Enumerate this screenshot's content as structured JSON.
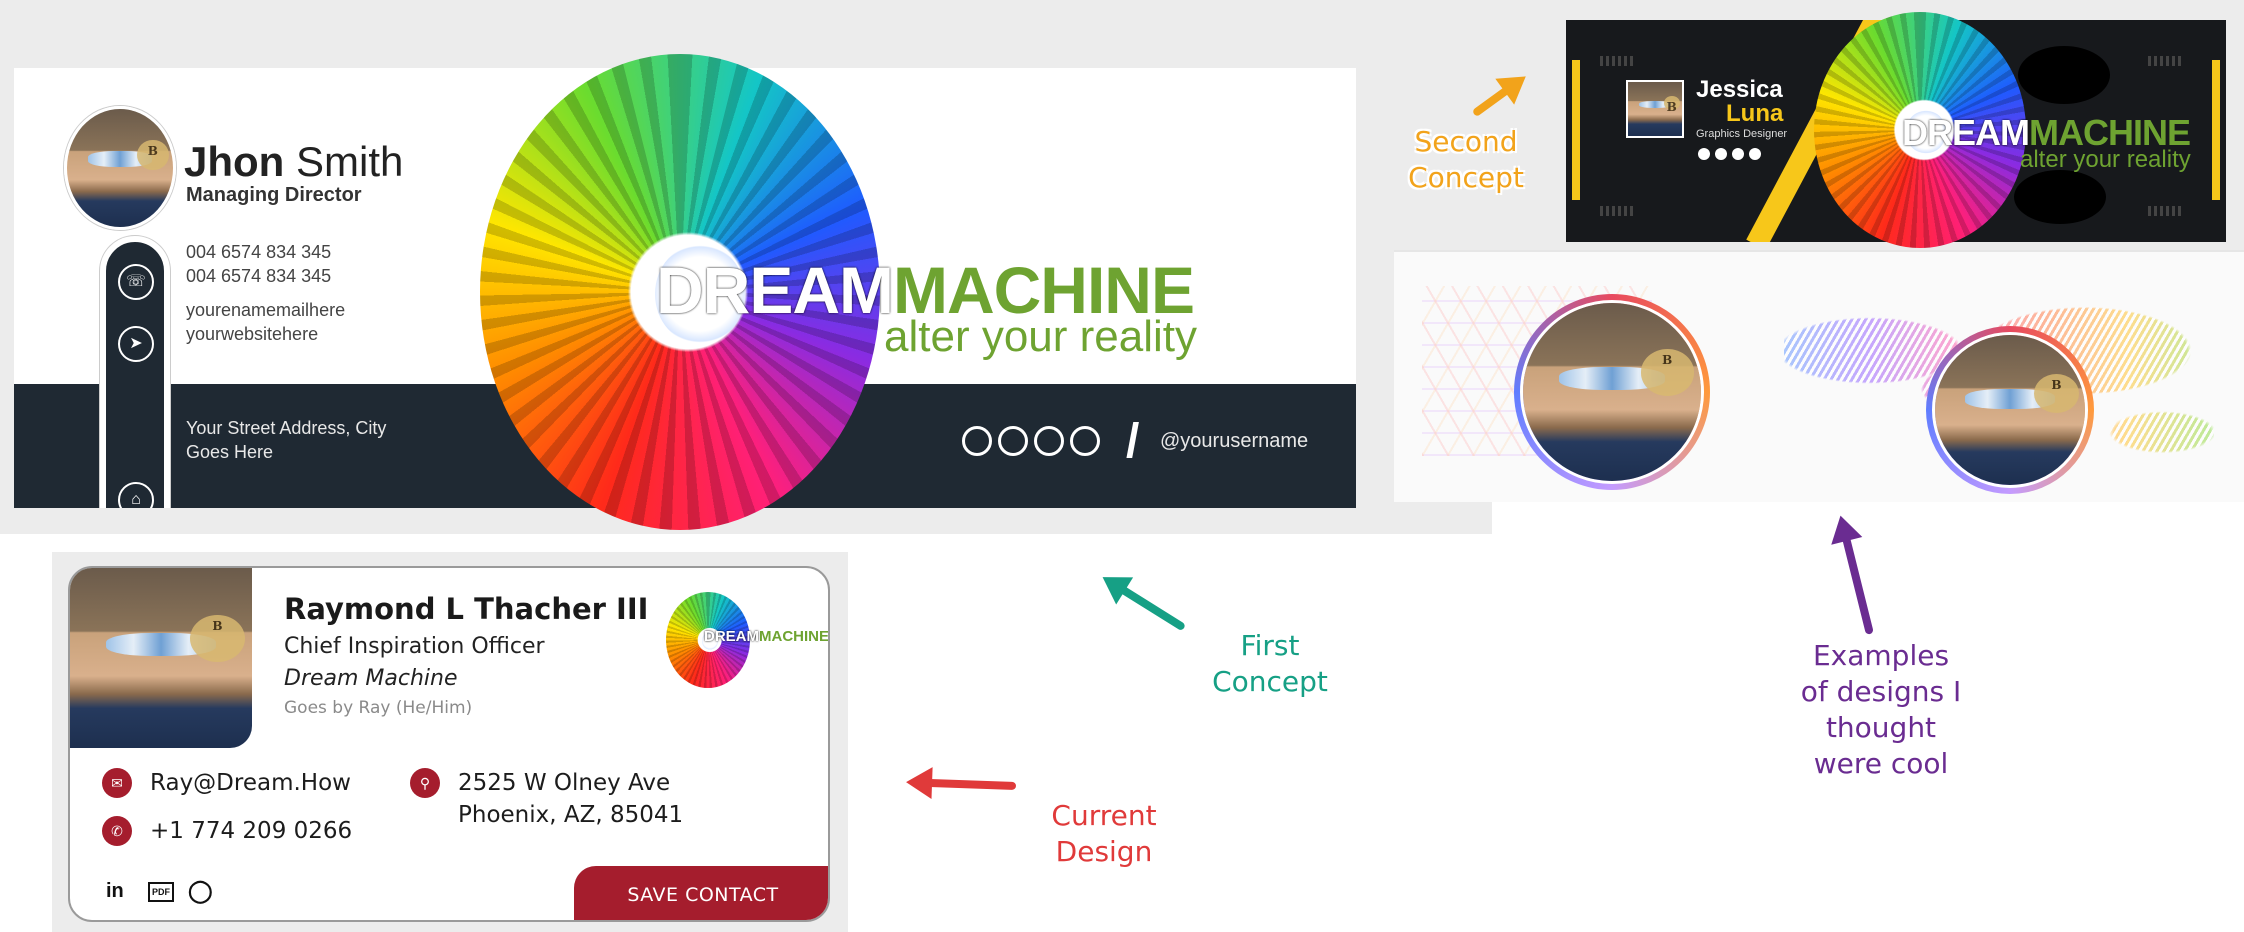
{
  "concept1": {
    "first_name": "Jhon",
    "last_name": "Smith",
    "role": "Managing Director",
    "phone1": "004 6574 834 345",
    "phone2": "004 6574 834 345",
    "email": "yourenamemailhere",
    "website": "yourwebsitehere",
    "address_line1": "Your Street Address, City",
    "address_line2": "Goes Here",
    "username": "@yourusername",
    "brand_left": "DREAM",
    "brand_right": "MACHINE",
    "tagline": "alter your reality",
    "icons": [
      "phone-icon",
      "cursor-icon",
      "home-icon"
    ]
  },
  "concept2": {
    "first_name": "Jessica",
    "last_name": "Luna",
    "role": "Graphics Designer",
    "brand_left": "DREAM",
    "brand_right": "MACHINE",
    "tagline": "alter your reality"
  },
  "current": {
    "name": "Raymond L Thacher III",
    "title": "Chief Inspiration Officer",
    "company": "Dream Machine",
    "pronouns": "Goes by Ray (He/Him)",
    "email": "Ray@Dream.How",
    "phone": "+1 774 209 0266",
    "address_line1": "2525 W Olney Ave",
    "address_line2": "Phoenix, AZ, 85041",
    "save_label": "SAVE CONTACT",
    "logo_left": "DREAM",
    "logo_right": "MACHINE",
    "social": [
      "in",
      "PDF",
      "whatsapp-icon"
    ],
    "accent": "#a51d2d"
  },
  "annotations": {
    "second_l1": "Second",
    "second_l2": "Concept",
    "first_l1": "First",
    "first_l2": "Concept",
    "current_l1": "Current",
    "current_l2": "Design",
    "examples_l1": "Examples",
    "examples_l2": "of designs I",
    "examples_l3": "thought",
    "examples_l4": "were cool",
    "colors": {
      "second": "#f2a31b",
      "first": "#16a085",
      "current": "#e03a3a",
      "examples": "#6a2c91"
    }
  },
  "brand_colors": {
    "green": "#6ea331",
    "dark": "#1f2933",
    "yellow": "#f7c71a"
  }
}
